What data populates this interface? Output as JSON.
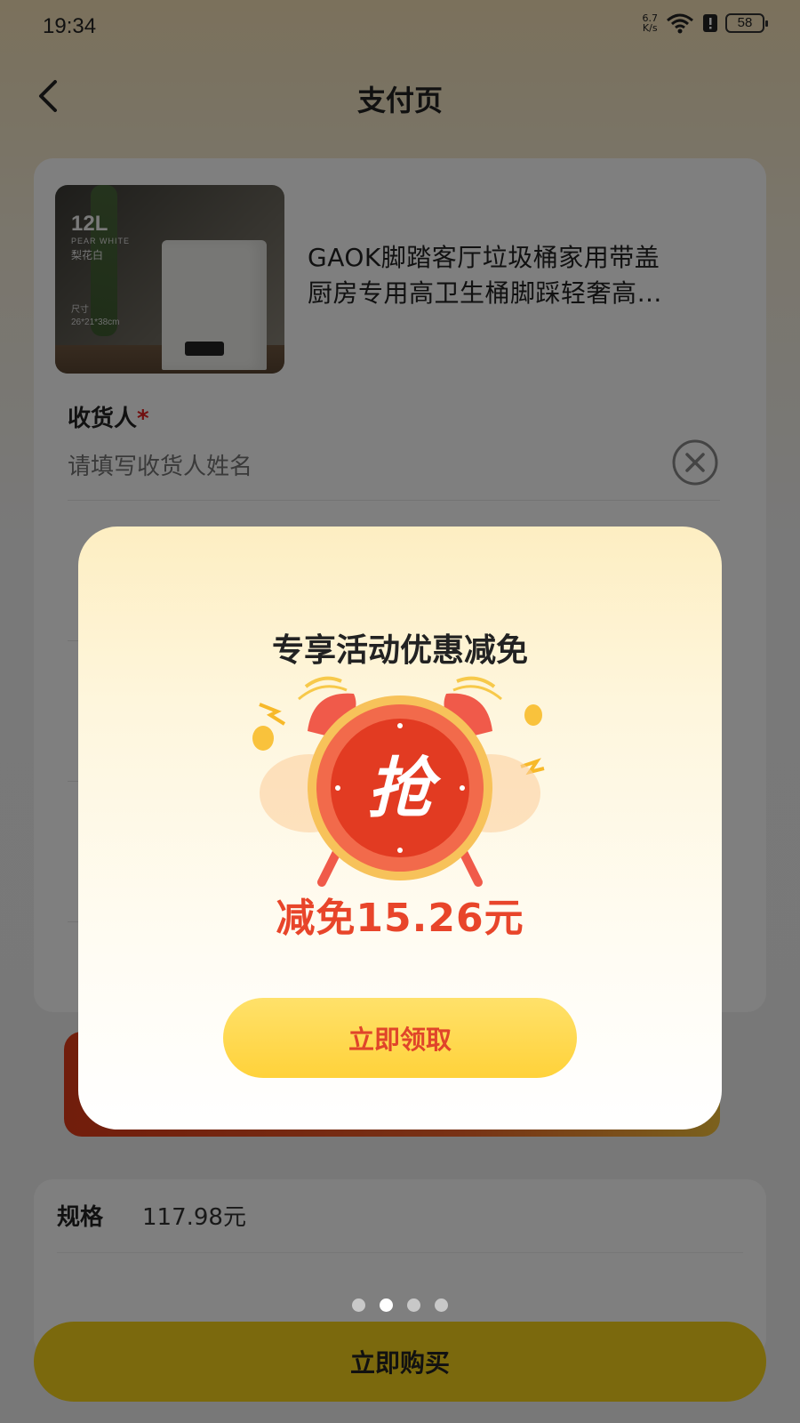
{
  "status_bar": {
    "time": "19:34",
    "net_speed_value": "6.7",
    "net_speed_unit": "K/s",
    "wifi_label": "6",
    "battery": "58"
  },
  "header": {
    "title": "支付页",
    "back_icon": "chevron-left-icon"
  },
  "product": {
    "title_line1": "GAOK脚踏客厅垃圾桶家用带盖",
    "title_line2": "厨房专用高卫生桶脚踩轻奢高…",
    "image_text": {
      "capacity": "12L",
      "color_en": "PEAR WHITE",
      "color_cn": "梨花白",
      "size_label": "尺寸",
      "size_value": "26*21*38cm"
    }
  },
  "form": {
    "receiver": {
      "label": "收货人",
      "required_mark": "*",
      "placeholder": "请填写收货人姓名"
    }
  },
  "spec": {
    "label": "规格",
    "price": "117.98元"
  },
  "buy_button": "立即购买",
  "popup": {
    "title": "专享活动优惠减免",
    "badge_char": "抢",
    "discount": "减免15.26元",
    "claim_button": "立即领取"
  },
  "pager": {
    "count": 4,
    "active_index": 1
  },
  "colors": {
    "accent_yellow": "#f7d31a",
    "discount_red": "#e8452a",
    "overlay": "rgba(0,0,0,0.5)"
  }
}
